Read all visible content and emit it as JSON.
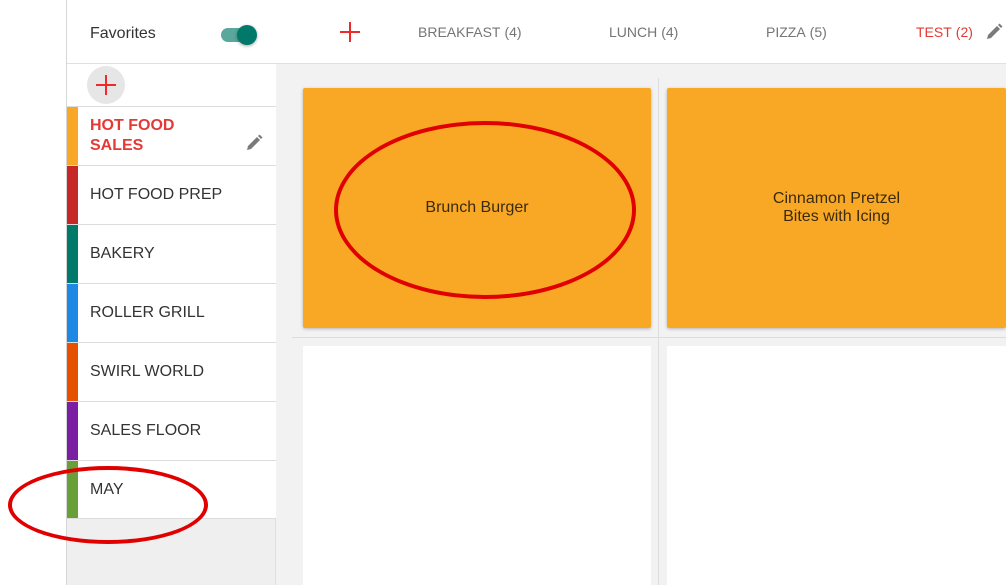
{
  "sidebar": {
    "favorites_label": "Favorites",
    "favorites_enabled": true,
    "categories": [
      {
        "label": "HOT FOOD SALES",
        "color": "#f9a825",
        "active": true
      },
      {
        "label": "HOT FOOD PREP",
        "color": "#c62828",
        "active": false
      },
      {
        "label": "BAKERY",
        "color": "#00796b",
        "active": false
      },
      {
        "label": "ROLLER GRILL",
        "color": "#1e88e5",
        "active": false
      },
      {
        "label": "SWIRL WORLD",
        "color": "#e65100",
        "active": false
      },
      {
        "label": "SALES FLOOR",
        "color": "#7b1fa2",
        "active": false
      },
      {
        "label": "MAY",
        "color": "#689f38",
        "active": false
      }
    ]
  },
  "tabs": [
    {
      "label": "BREAKFAST",
      "count": "(4)",
      "active": false
    },
    {
      "label": "LUNCH",
      "count": "(4)",
      "active": false
    },
    {
      "label": "PIZZA",
      "count": "(5)",
      "active": false
    },
    {
      "label": "TEST",
      "count": "(2)",
      "active": true
    }
  ],
  "tiles": [
    {
      "label": "Brunch Burger"
    },
    {
      "label": "Cinnamon Pretzel\nBites with Icing"
    }
  ],
  "colors": {
    "accent": "#e53935",
    "tile": "#f9a825",
    "toggle": "#00796b",
    "annotation": "#e00000"
  }
}
